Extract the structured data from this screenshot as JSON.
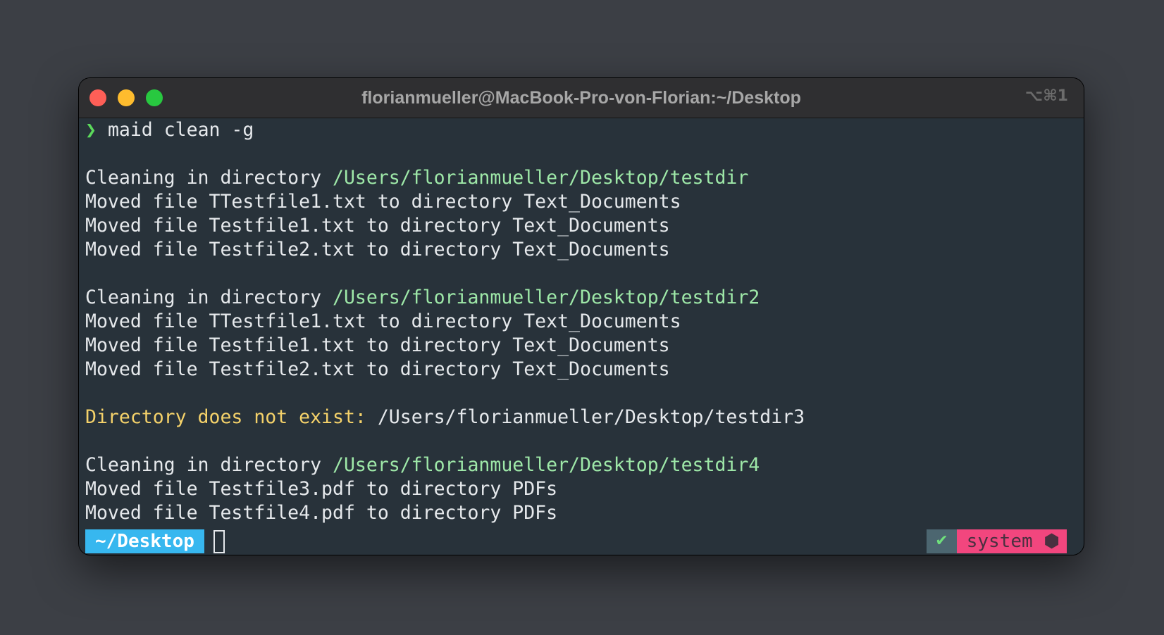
{
  "window": {
    "title": "florianmueller@MacBook-Pro-von-Florian:~/Desktop",
    "shortcut": "⌥⌘1"
  },
  "terminal": {
    "prompt_symbol": "❯",
    "command": "maid clean -g",
    "lines": [
      {
        "prefix": "Cleaning in directory ",
        "path": "/Users/florianmueller/Desktop/testdir"
      },
      {
        "text": "Moved file TTestfile1.txt to directory Text_Documents"
      },
      {
        "text": "Moved file Testfile1.txt to directory Text_Documents"
      },
      {
        "text": "Moved file Testfile2.txt to directory Text_Documents"
      },
      {
        "prefix": "Cleaning in directory ",
        "path": "/Users/florianmueller/Desktop/testdir2"
      },
      {
        "text": "Moved file TTestfile1.txt to directory Text_Documents"
      },
      {
        "text": "Moved file Testfile1.txt to directory Text_Documents"
      },
      {
        "text": "Moved file Testfile2.txt to directory Text_Documents"
      },
      {
        "warning": "Directory does not exist: ",
        "path": "/Users/florianmueller/Desktop/testdir3"
      },
      {
        "prefix": "Cleaning in directory ",
        "path": "/Users/florianmueller/Desktop/testdir4"
      },
      {
        "text": "Moved file Testfile3.pdf to directory PDFs"
      },
      {
        "text": "Moved file Testfile4.pdf to directory PDFs"
      }
    ]
  },
  "statusline": {
    "directory": "~/Desktop",
    "status_check": "✔",
    "environment": "system",
    "environment_icon": "⬢"
  },
  "colors": {
    "background": "#3c3f45",
    "terminal_bg": "#28323a",
    "prompt_green": "#5bd95b",
    "path_green": "#9ee8a8",
    "warning_yellow": "#f5d26a",
    "dir_segment_blue": "#37b7ef",
    "env_segment_pink": "#f2467e"
  }
}
